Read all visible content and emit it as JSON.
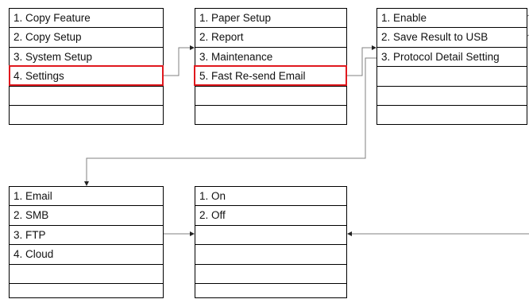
{
  "boxes": [
    {
      "id": "box-1",
      "rows": [
        "1. Copy Feature",
        "2. Copy Setup",
        "3. System Setup",
        "4. Settings",
        "",
        ""
      ]
    },
    {
      "id": "box-2",
      "rows": [
        "1. Paper Setup",
        "2. Report",
        "3. Maintenance",
        "5. Fast Re-send Email",
        "",
        ""
      ]
    },
    {
      "id": "box-3",
      "rows": [
        "1. Enable",
        "2. Save Result to USB",
        "3. Protocol Detail Setting",
        "",
        "",
        ""
      ]
    },
    {
      "id": "box-4",
      "rows": [
        "1. Email",
        "2. SMB",
        "3. FTP",
        "4. Cloud",
        "",
        ""
      ]
    },
    {
      "id": "box-5",
      "rows": [
        "1. On",
        "2. Off",
        "",
        "",
        "",
        ""
      ]
    }
  ],
  "highlight_color": "#e0191e",
  "line_color": "#808080"
}
